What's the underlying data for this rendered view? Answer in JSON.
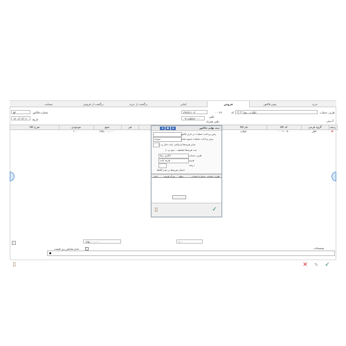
{
  "tabs": [
    "خرید",
    "پیش فاکتور",
    "فروش",
    "امانی",
    "برگشت از خرید",
    "برگشت از فروش",
    "ضمانت"
  ],
  "header": {
    "account_party_label": "طرف حساب",
    "account_party_value": "انکاری رضا",
    "code_label": "کد",
    "code_value": "۰۰۰۲۷",
    "phone_label": "تلفن",
    "phone_value": "۳۷۷۳۱۱۰۳",
    "mobile_label": "تلفن همراه",
    "mobile_value": "۰۹۱۱۵۷۸۶۰۰۰",
    "address_label": "آدرس",
    "invoice_no_label": "شماره فاکتور",
    "invoice_no_value": "۵۲",
    "date_label": "تاریخ",
    "date_value": "۱۴۰۱/۰۲/۰۶"
  },
  "grid": {
    "columns": [
      "ردیف",
      "گروه فرعی",
      "کد کالا",
      "نام کالا",
      "تعداد",
      "واحد",
      "فی",
      "جمع",
      "موجودی",
      "شرح کالا"
    ],
    "rows": [
      {
        "row": "۱",
        "subgroup": "انبار",
        "code": "۰۰۰۱۰۰۸",
        "name": "لپتاپ",
        "qty": "۱",
        "unit": "",
        "price": "",
        "total": "۱۴۵,۰۰۰,۰۰۰",
        "stock": "۱۰۰",
        "desc": ""
      }
    ]
  },
  "dialog": {
    "title": "ثبت نهایی فاکتور",
    "line1_label": "پیش پرداخت عملیات در ابزار فاکتور",
    "line1_value": "۰",
    "line2_label": "پیش پرداخت عملیات تسویه نقدی",
    "line2_value": "سپرده",
    "line3_label": "سایر هزینه‌ها (دریافتی بابت حمل و...)",
    "line3_value": "۰",
    "line4_label": "ثبت هزینه‌ها (تخفیف - سود و...)",
    "payment_label": "طرف حساب",
    "payment_value": "انکاری رضا",
    "fee_label": "هزینه",
    "fee_value": "هزینه ثابت",
    "percent_label": "درصد",
    "percent_value": "۰",
    "note": "اعمال هزینه‌ها در تمام کالاها",
    "table_headers": [
      "طرف حساب",
      "شماره حساب",
      "مبلغ",
      "مرکز هزینه",
      "حذف"
    ]
  },
  "footer": {
    "total_label": "جمع کل",
    "total_value": "۱۴۵,۰۰۰,۰۰۰",
    "qty_total": "۱۰۰",
    "descriptions_label": "توضیحات",
    "show_label": "عدم نمایش ریز قیمت",
    "search_hint": "●"
  },
  "colors": {
    "accent": "#3d6fb8",
    "ok": "#2e8b57",
    "danger": "#d32f2f"
  }
}
